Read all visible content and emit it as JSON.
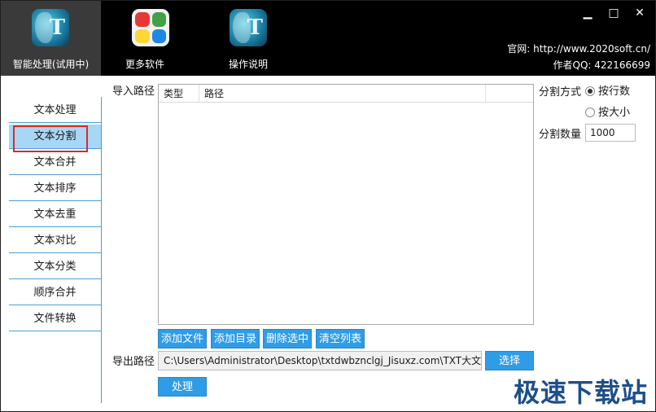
{
  "topbar": {
    "tools": [
      {
        "label": "智能处理(试用中)",
        "icon": "txt-app-icon",
        "active": true
      },
      {
        "label": "更多软件",
        "icon": "tiles-icon",
        "active": false
      },
      {
        "label": "操作说明",
        "icon": "txt-app-icon",
        "active": false
      }
    ],
    "icon_letter": "T",
    "website": "官网: http://www.2020soft.cn/",
    "author_qq": "作者QQ: 422166699",
    "window_controls": {
      "minimize": "▁",
      "maximize": "□",
      "close": "✕"
    }
  },
  "nav": {
    "items": [
      {
        "label": "文本处理"
      },
      {
        "label": "文本分割"
      },
      {
        "label": "文本合并"
      },
      {
        "label": "文本排序"
      },
      {
        "label": "文本去重"
      },
      {
        "label": "文本对比"
      },
      {
        "label": "文本分类"
      },
      {
        "label": "顺序合并"
      },
      {
        "label": "文件转换"
      }
    ],
    "active_index": 1
  },
  "import": {
    "label": "导入路径",
    "columns": [
      "类型",
      "路径"
    ],
    "rows": []
  },
  "list_actions": {
    "add_file": "添加文件",
    "add_dir": "添加目录",
    "remove_selected": "删除选中",
    "clear_list": "清空列表"
  },
  "export": {
    "label": "导出路径",
    "path": "C:\\Users\\Administrator\\Desktop\\txtdwbznclgj_Jisuxz.com\\TXT大文本智",
    "choose": "选择"
  },
  "process_button": "处理",
  "split": {
    "method_label": "分割方式",
    "options": [
      "按行数",
      "按大小"
    ],
    "selected": 0,
    "count_label": "分割数量",
    "count_value": "1000"
  },
  "watermark": "极速下载站",
  "colors": {
    "accent": "#2f9ce6",
    "nav_active": "#a8d6f5",
    "highlight": "#e02828",
    "topbar": "#000000"
  }
}
